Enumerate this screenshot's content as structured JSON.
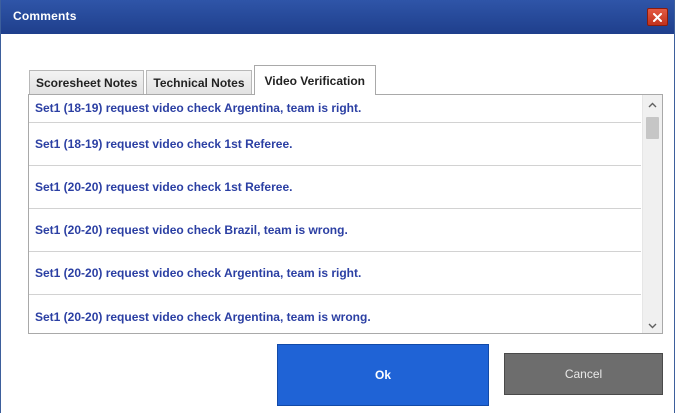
{
  "window": {
    "title": "Comments",
    "colors": {
      "titlebar": "#2f55a8",
      "close": "#c1321c",
      "list_text": "#2b3fa3",
      "ok": "#1f63d6",
      "cancel": "#6d6d6d"
    }
  },
  "tabs": [
    {
      "label": "Scoresheet Notes",
      "active": false
    },
    {
      "label": "Technical Notes",
      "active": false
    },
    {
      "label": "Video Verification",
      "active": true
    }
  ],
  "list": {
    "items": [
      "Set1 (18-19) request video check  Argentina, team is right.",
      "Set1 (18-19) request video check  1st Referee.",
      "Set1 (20-20) request video check  1st Referee.",
      "Set1 (20-20) request video check  Brazil, team is wrong.",
      "Set1 (20-20) request video check  Argentina, team is right.",
      "Set1 (20-20) request video check  Argentina, team is wrong."
    ]
  },
  "buttons": {
    "ok": "Ok",
    "cancel": "Cancel"
  },
  "icons": {
    "close": "close-icon",
    "scroll_up": "chevron-up-icon",
    "scroll_down": "chevron-down-icon"
  }
}
